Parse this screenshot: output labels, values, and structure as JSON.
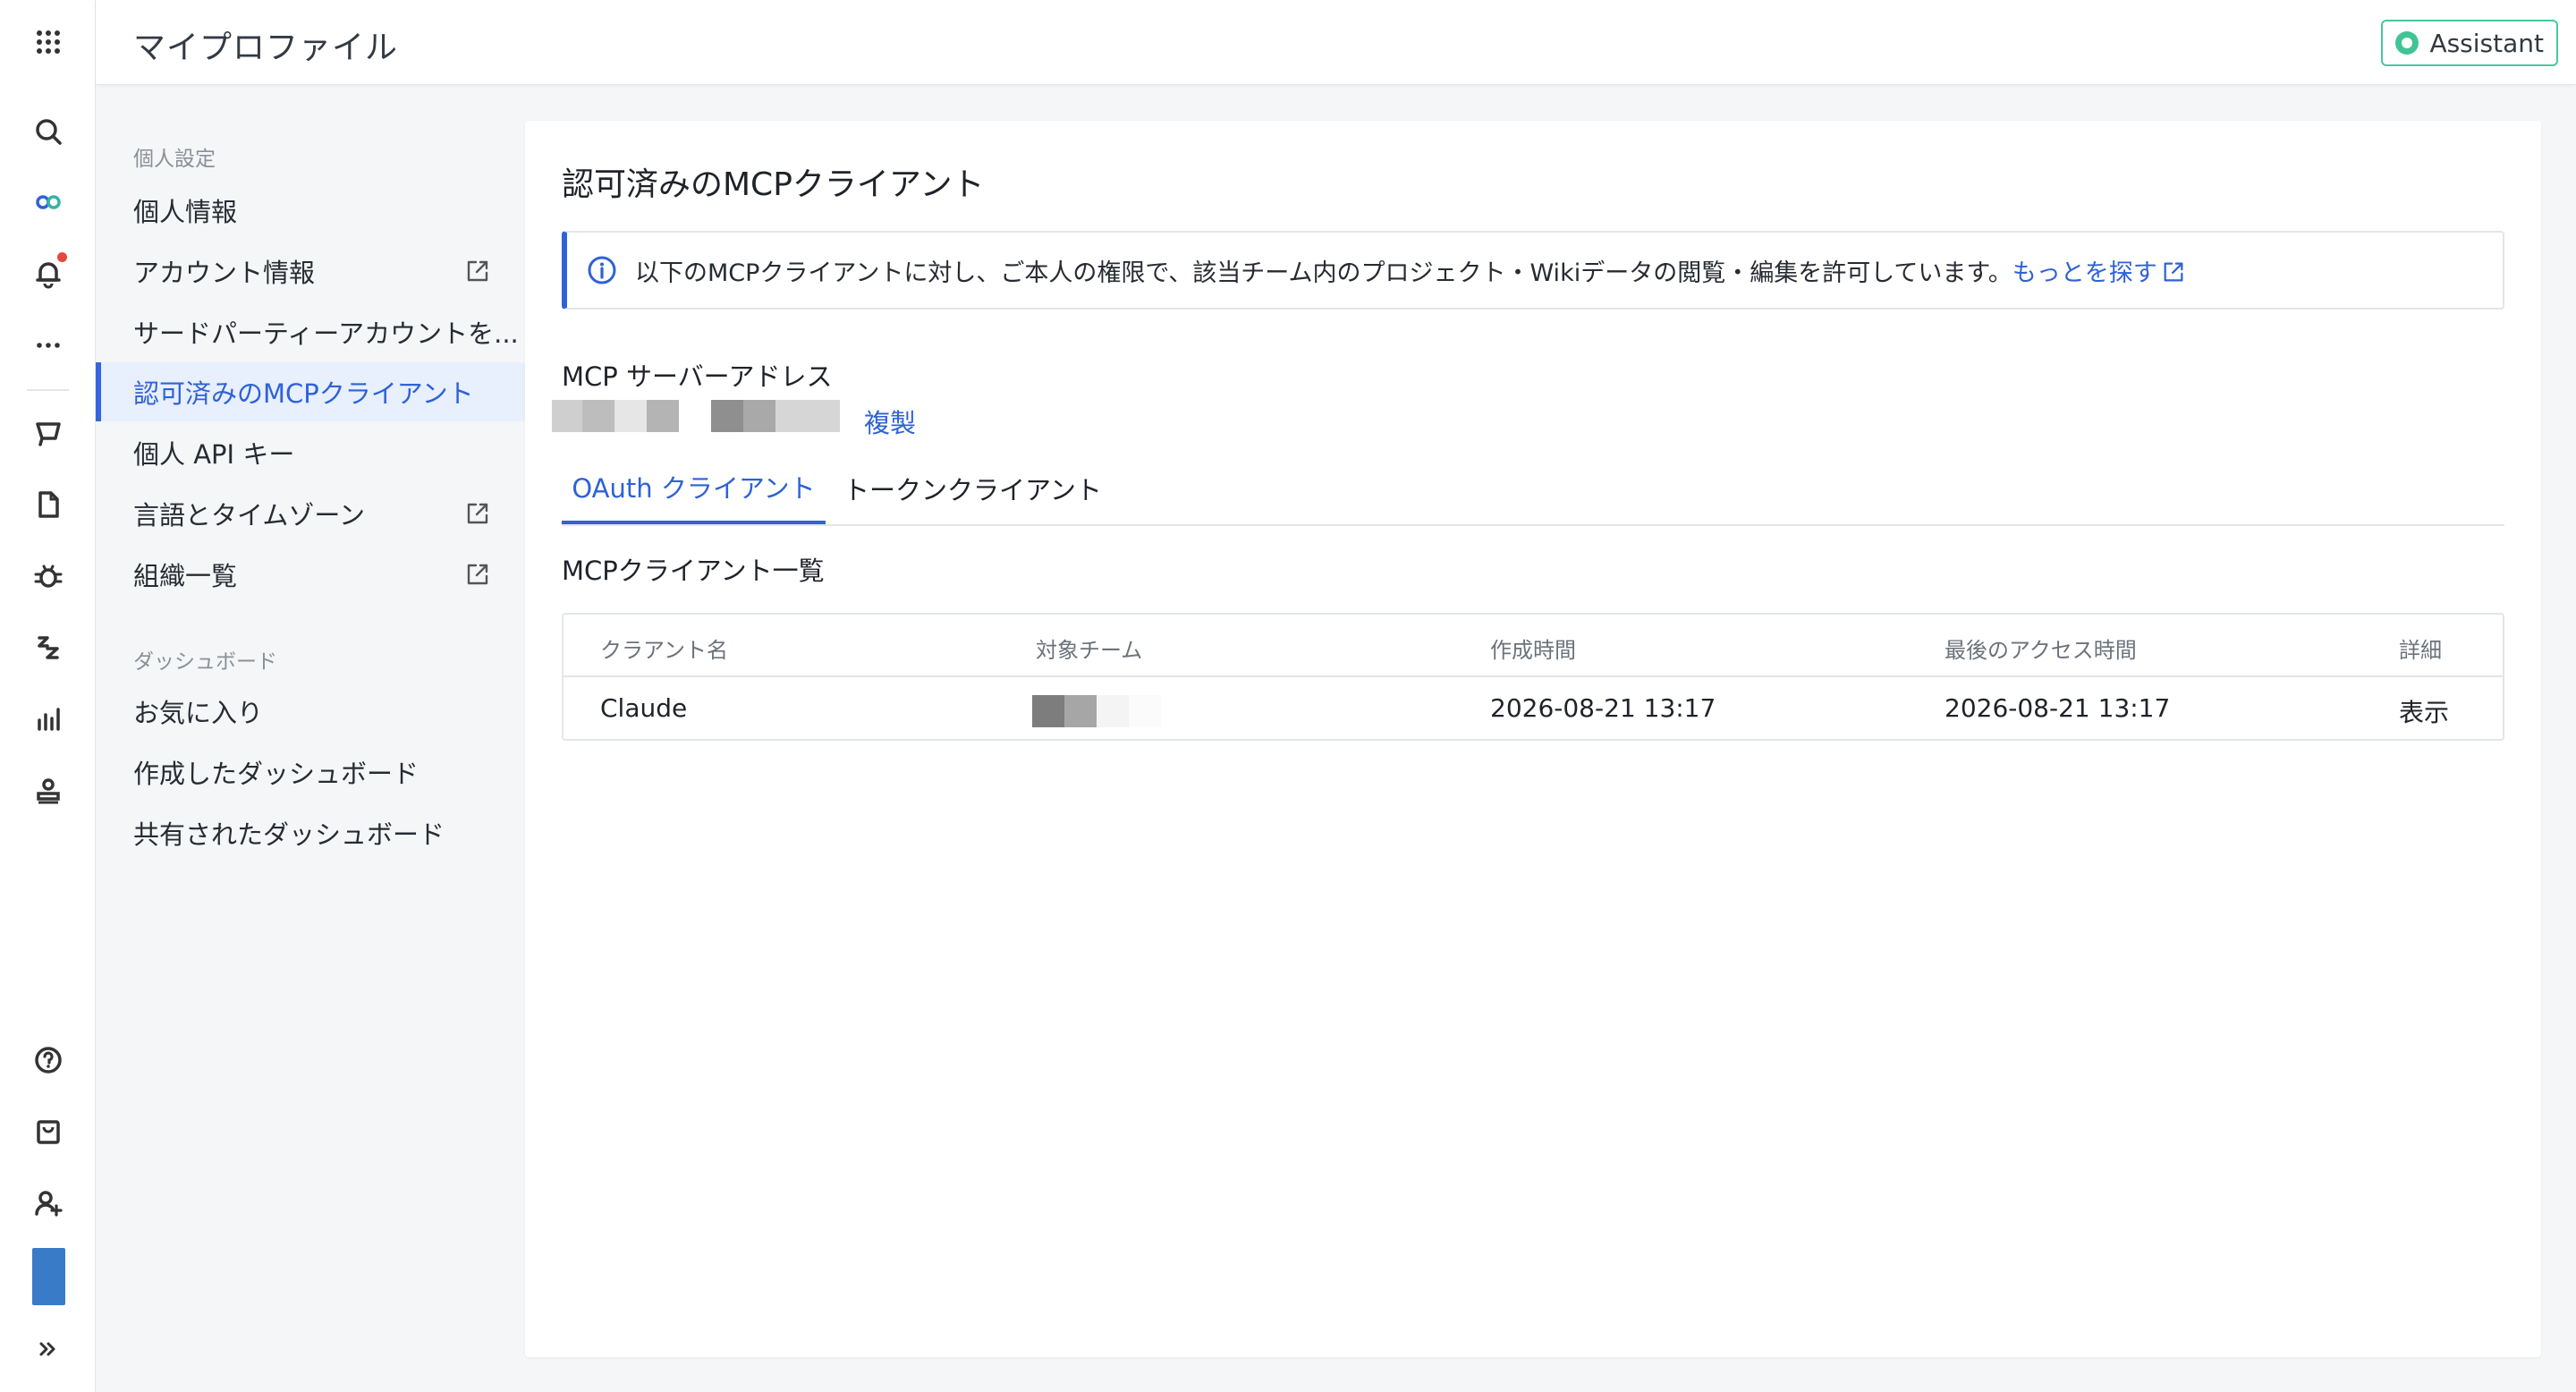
{
  "header": {
    "title": "マイプロファイル",
    "assistant_label": "Assistant"
  },
  "rail": {
    "icons": [
      "apps-grid-icon",
      "search-icon",
      "infinity-icon",
      "bell-icon",
      "more-dots-icon",
      "board-icon",
      "document-icon",
      "bug-icon",
      "sleep-icon",
      "chart-icon",
      "stamp-icon",
      "help-icon",
      "bag-icon",
      "add-user-icon",
      "expand-icon"
    ]
  },
  "sidebar": {
    "section_personal": "個人設定",
    "items": [
      {
        "label": "個人情報"
      },
      {
        "label": "アカウント情報"
      },
      {
        "label": "サードパーティーアカウントを..."
      },
      {
        "label": "認可済みのMCPクライアント"
      },
      {
        "label": "個人 API キー"
      },
      {
        "label": "言語とタイムゾーン"
      },
      {
        "label": "組織一覧"
      }
    ],
    "section_dashboard": "ダッシュボード",
    "dashboard_items": [
      {
        "label": "お気に入り"
      },
      {
        "label": "作成したダッシュボード"
      },
      {
        "label": "共有されたダッシュボード"
      }
    ]
  },
  "main": {
    "title": "認可済みのMCPクライアント",
    "info_text": "以下のMCPクライアントに対し、ご本人の権限で、該当チーム内のプロジェクト・Wikiデータの閲覧・編集を許可しています。",
    "info_link": "もっとを探す",
    "server_address_label": "MCP サーバーアドレス",
    "copy_label": "複製",
    "tabs": [
      {
        "label": "OAuth クライアント"
      },
      {
        "label": "トークンクライアント"
      }
    ],
    "list_title": "MCPクライアント一覧",
    "table": {
      "headers": [
        "クラアント名",
        "対象チーム",
        "作成時間",
        "最後のアクセス時間",
        "詳細"
      ],
      "rows": [
        {
          "name": "Claude",
          "created": "2026-08-21 13:17",
          "last_access": "2026-08-21 13:17",
          "action": "表示"
        }
      ]
    }
  },
  "colors": {
    "accent": "#2f62d6",
    "assistant_border": "#4ac6a0",
    "notification": "#e5483b"
  }
}
